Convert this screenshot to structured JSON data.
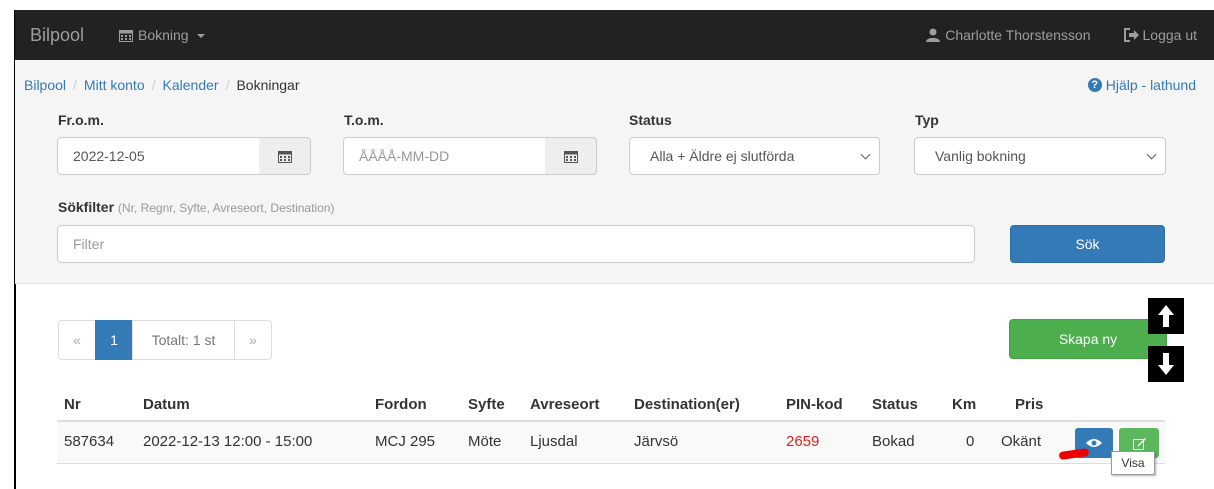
{
  "navbar": {
    "brand": "Bilpool",
    "booking_menu": "Bokning",
    "user_name": "Charlotte Thorstensson",
    "logout": "Logga ut"
  },
  "breadcrumb": [
    "Bilpool",
    "Mitt konto",
    "Kalender",
    "Bokningar"
  ],
  "help": "Hjälp - lathund",
  "filters": {
    "from_label": "Fr.o.m.",
    "from_value": "2022-12-05",
    "to_label": "T.o.m.",
    "to_placeholder": "ÅÅÅÅ-MM-DD",
    "status_label": "Status",
    "status_value": "Alla + Äldre ej slutförda",
    "type_label": "Typ",
    "type_value": "Vanlig bokning",
    "search_label": "Sökfilter",
    "search_hint": "(Nr, Regnr, Syfte, Avreseort, Destination)",
    "search_placeholder": "Filter",
    "search_button": "Sök"
  },
  "pagination": {
    "prev": "«",
    "current": "1",
    "total": "Totalt: 1 st",
    "next": "»"
  },
  "create_button": "Skapa ny",
  "table": {
    "headers": [
      "Nr",
      "Datum",
      "Fordon",
      "Syfte",
      "Avreseort",
      "Destination(er)",
      "PIN-kod",
      "Status",
      "Km",
      "Pris"
    ],
    "rows": [
      {
        "nr": "587634",
        "datum": "2022-12-13 12:00 - 15:00",
        "fordon": "MCJ 295",
        "syfte": "Möte",
        "avreseort": "Ljusdal",
        "destination": "Järvsö",
        "pin": "2659",
        "status": "Bokad",
        "km": "0",
        "pris": "Okänt"
      }
    ]
  },
  "tooltip": "Visa",
  "colors": {
    "navbar": "#222222",
    "primary": "#337ab7",
    "success": "#5cb85c",
    "pin": "#e0201c"
  }
}
